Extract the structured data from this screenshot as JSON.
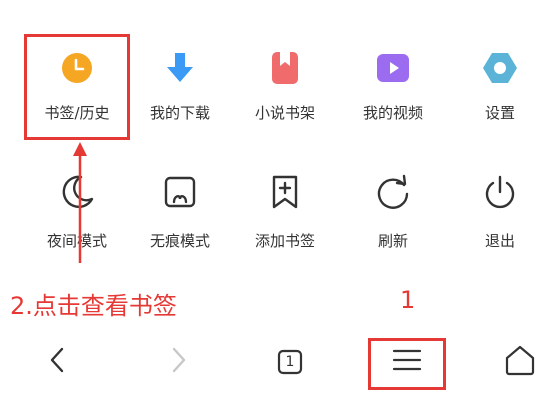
{
  "menu": {
    "row1": [
      {
        "label": "书签/历史",
        "icon": "clock-icon",
        "color": "#f5a623"
      },
      {
        "label": "我的下载",
        "icon": "download-arrow-icon",
        "color": "#3a9af5"
      },
      {
        "label": "小说书架",
        "icon": "bookmark-book-icon",
        "color": "#f06b6b"
      },
      {
        "label": "我的视频",
        "icon": "play-video-icon",
        "color": "#9b6cf0"
      },
      {
        "label": "设置",
        "icon": "gear-icon",
        "color": "#5bb4d8"
      }
    ],
    "row2": [
      {
        "label": "夜间模式",
        "icon": "moon-icon"
      },
      {
        "label": "无痕模式",
        "icon": "incognito-icon"
      },
      {
        "label": "添加书签",
        "icon": "add-bookmark-icon"
      },
      {
        "label": "刷新",
        "icon": "refresh-icon"
      },
      {
        "label": "退出",
        "icon": "power-icon"
      }
    ]
  },
  "annotations": {
    "step2": "2.点击查看书签",
    "step1": "1",
    "color": "#e53935"
  },
  "bottom_nav": {
    "tabs_count": "1",
    "items": [
      "back-icon",
      "forward-icon",
      "tabs-icon",
      "menu-icon",
      "home-icon"
    ]
  }
}
